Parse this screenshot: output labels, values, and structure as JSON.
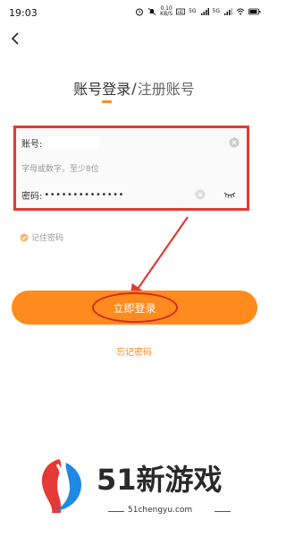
{
  "status_bar": {
    "time": "19:03",
    "speed_top": "0.10",
    "speed_bottom": "KB/S",
    "network_1": "5G",
    "network_2": "5G"
  },
  "header": {
    "login_title": "账号登录",
    "separator": "/",
    "register_title": "注册账号"
  },
  "form": {
    "account_label": "账号:",
    "hint": "字母或数字，至少8位",
    "password_label": "密码:",
    "password_value": "••••••••••••••"
  },
  "remember": {
    "label": "记住密码"
  },
  "actions": {
    "login_label": "立即登录",
    "forgot_label": "忘记密码"
  },
  "watermark": {
    "title": "51新游戏",
    "url": "51chengyu.com"
  },
  "colors": {
    "accent": "#ff8a1e",
    "annotation": "#e53935"
  }
}
